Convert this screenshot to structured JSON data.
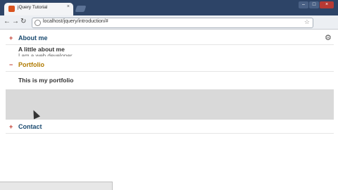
{
  "browser": {
    "tab_title": "jQuery Tutorial",
    "url": "localhost/jquery/introduction/#",
    "close_glyph": "×"
  },
  "sections": [
    {
      "title": "About me",
      "toggle": "+",
      "body_lines": [
        "A little about me",
        "I am a web developer..."
      ]
    },
    {
      "title": "Portfolio",
      "toggle": "−",
      "body_lines": [
        "This is my portfolio"
      ]
    },
    {
      "title": "Contact",
      "toggle": "+",
      "body_lines": []
    }
  ],
  "statusbar": {
    "text": ""
  },
  "colors": {
    "accent": "#1a4a70",
    "active_title": "#b07a00",
    "toggle": "#c0392b",
    "panel": "#d9d9d9"
  }
}
